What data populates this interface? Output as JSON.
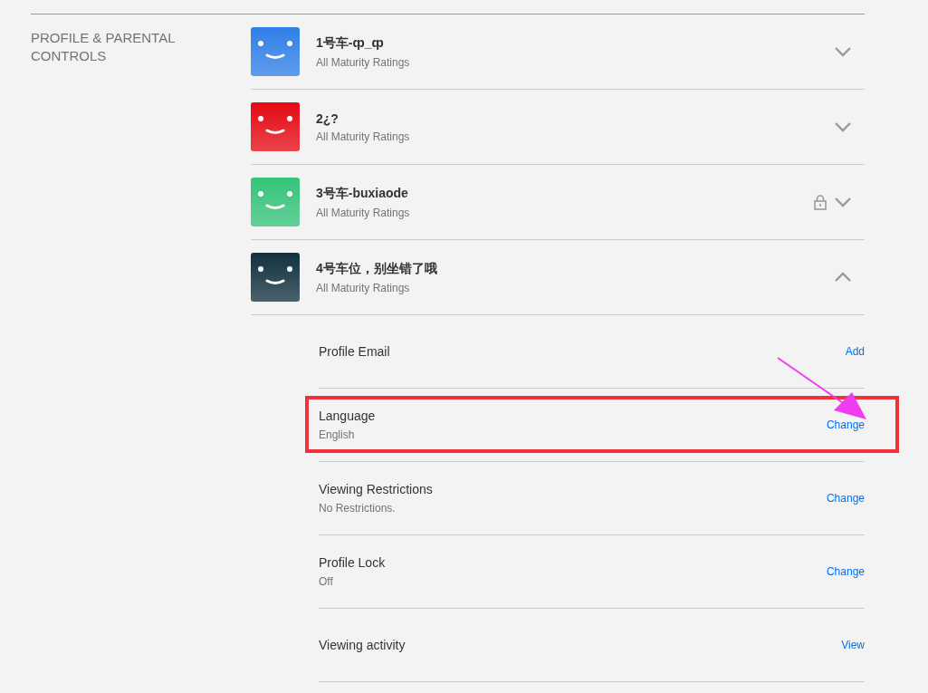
{
  "section": {
    "heading": "PROFILE & PARENTAL CONTROLS"
  },
  "profiles": [
    {
      "name": "1号车-ȹ_ȹ",
      "rating": "All Maturity Ratings",
      "color": "#2f7fe8",
      "locked": false,
      "expanded": false
    },
    {
      "name": "2¿?",
      "rating": "All Maturity Ratings",
      "color": "#e50914",
      "locked": false,
      "expanded": false
    },
    {
      "name": "3号车-buxiaode",
      "rating": "All Maturity Ratings",
      "color": "#35c47a",
      "locked": true,
      "expanded": false
    },
    {
      "name": "4号车位，别坐错了哦",
      "rating": "All Maturity Ratings",
      "color": "#12313f",
      "locked": false,
      "expanded": true
    }
  ],
  "settings": [
    {
      "label": "Profile Email",
      "action": "Add",
      "highlighted": false
    },
    {
      "label": "Language",
      "value": "English",
      "action": "Change",
      "highlighted": true
    },
    {
      "label": "Viewing Restrictions",
      "value": "No Restrictions.",
      "action": "Change",
      "highlighted": false
    },
    {
      "label": "Profile Lock",
      "value": "Off",
      "action": "Change",
      "highlighted": false
    },
    {
      "label": "Viewing activity",
      "action": "View",
      "highlighted": false
    }
  ]
}
